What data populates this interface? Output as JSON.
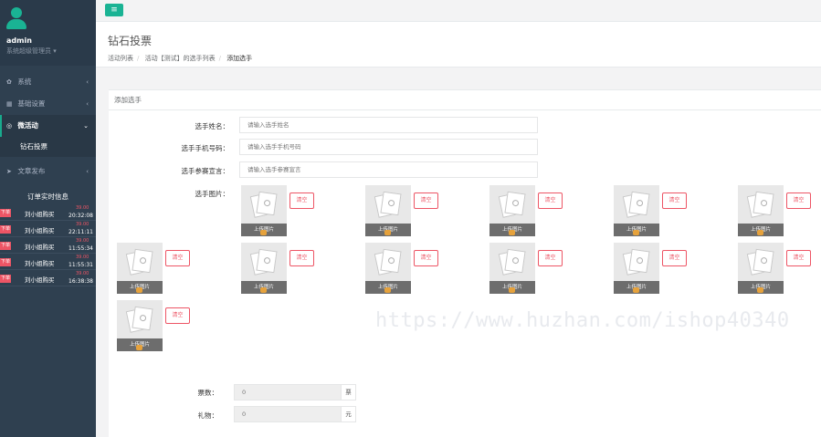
{
  "sidebar": {
    "user": {
      "name": "admin",
      "role": "系统超级管理员"
    },
    "items": [
      {
        "label": "系统",
        "icon": "gear-icon"
      },
      {
        "label": "基础设置",
        "icon": "grid-icon"
      },
      {
        "label": "微活动",
        "icon": "dribbble-icon"
      },
      {
        "label": "钻石投票"
      },
      {
        "label": "文章发布",
        "icon": "send-icon"
      }
    ],
    "orders_title": "订单实时信息",
    "orders": [
      {
        "badge": "下单",
        "name": "刘小姐购买",
        "amount": "39.00",
        "time": "20:32:08"
      },
      {
        "badge": "下单",
        "name": "刘小姐购买",
        "amount": "39.00",
        "time": "22:11:11"
      },
      {
        "badge": "下单",
        "name": "刘小姐购买",
        "amount": "39.00",
        "time": "11:55:34"
      },
      {
        "badge": "下单",
        "name": "刘小姐购买",
        "amount": "39.00",
        "time": "11:55:31"
      },
      {
        "badge": "下单",
        "name": "刘小姐购买",
        "amount": "39.00",
        "time": "16:38:38"
      }
    ]
  },
  "header": {
    "title": "钻石投票",
    "breadcrumbs": [
      "活动列表",
      "活动【测试】的选手列表",
      "添加选手"
    ]
  },
  "panel": {
    "title": "添加选手"
  },
  "form": {
    "name_label": "选手姓名：",
    "name_placeholder": "请输入选手姓名",
    "phone_label": "选手手机号码：",
    "phone_placeholder": "请输入选手手机号码",
    "manifesto_label": "选手参赛宣言：",
    "manifesto_placeholder": "请输入选手参赛宣言",
    "photos_label": "选手图片：",
    "upload_label": "上传图片",
    "clear_label": "清空",
    "votes_label": "票数：",
    "votes_value": "0",
    "votes_unit": "票",
    "gift_label": "礼物：",
    "gift_value": "0",
    "gift_unit": "元"
  },
  "watermark": "https://www.huzhan.com/ishop40340",
  "colors": {
    "sidebar": "#2f4050",
    "accent": "#1ab394",
    "danger": "#ed5565"
  }
}
